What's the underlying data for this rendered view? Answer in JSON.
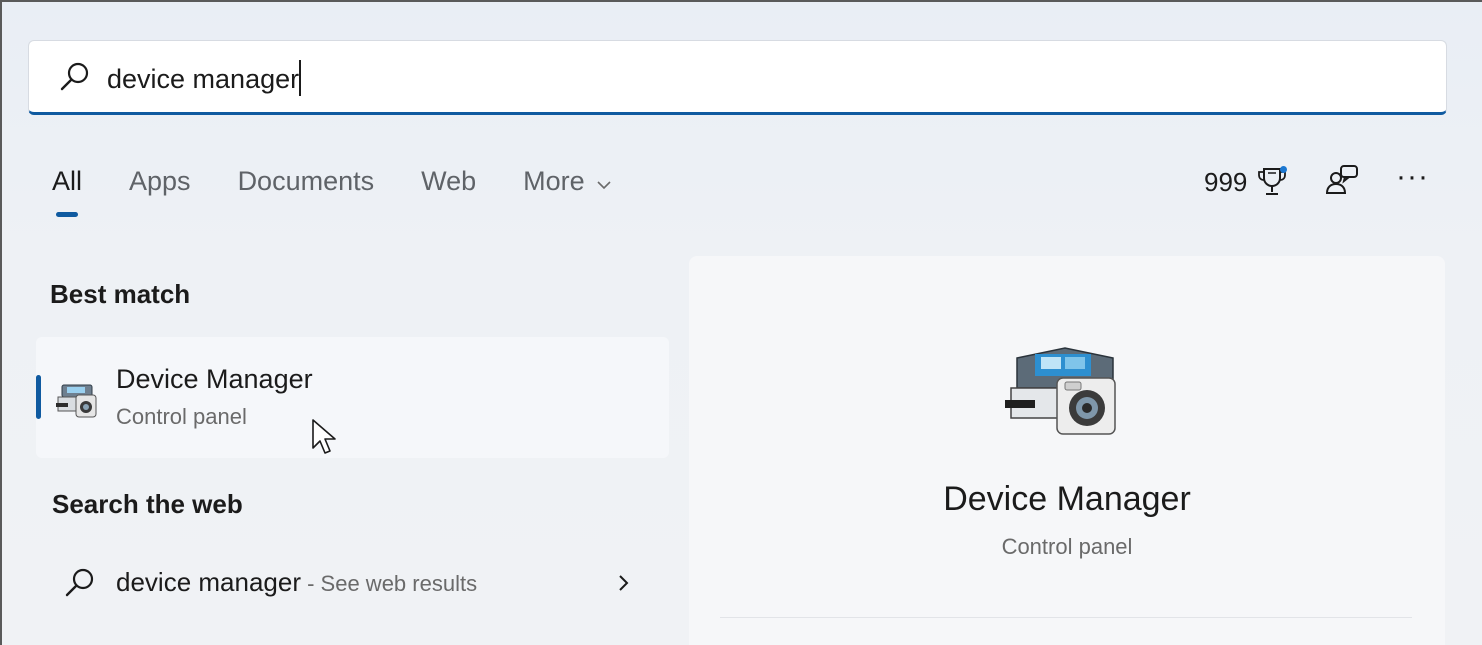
{
  "search": {
    "value": "device manager",
    "icon": "search-icon"
  },
  "tabs": [
    {
      "label": "All",
      "active": true
    },
    {
      "label": "Apps",
      "active": false
    },
    {
      "label": "Documents",
      "active": false
    },
    {
      "label": "Web",
      "active": false
    },
    {
      "label": "More",
      "active": false
    }
  ],
  "toolbar": {
    "points": "999",
    "trophy_icon": "trophy-icon",
    "account_icon": "account-switch-icon",
    "more_icon": "more-options-icon",
    "more_glyph": "···"
  },
  "best_match": {
    "heading": "Best match",
    "title": "Device Manager",
    "subtitle": "Control panel",
    "icon": "device-manager-icon"
  },
  "web": {
    "heading": "Search the web",
    "query": "device manager",
    "hint": " - See web results"
  },
  "preview": {
    "title": "Device Manager",
    "subtitle": "Control panel",
    "icon": "device-manager-icon"
  },
  "colors": {
    "accent": "#0f5aa0",
    "notification_dot": "#1b77d1"
  }
}
